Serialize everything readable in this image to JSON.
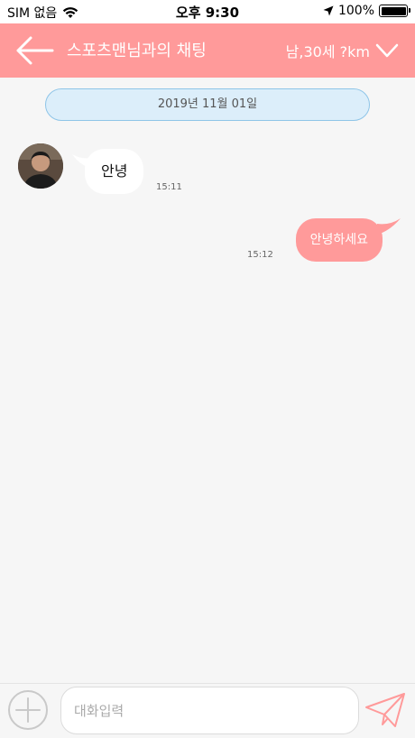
{
  "status_bar": {
    "carrier": "SIM 없음",
    "time": "오후 9:30",
    "battery": "100%",
    "battery_level": 1.0
  },
  "nav": {
    "title": "스포츠맨님과의 채팅",
    "partner_info": "남,30세 ?km"
  },
  "chat": {
    "date": "2019년 11월 01일",
    "messages": [
      {
        "direction": "incoming",
        "text": "안녕",
        "time": "15:11"
      },
      {
        "direction": "outgoing",
        "text": "안녕하세요",
        "time": "15:12"
      }
    ]
  },
  "input": {
    "placeholder": "대화입력",
    "value": ""
  },
  "colors": {
    "accent": "#ff9a9a",
    "date_pill_bg": "#dceefa",
    "date_pill_border": "#8fc5e8",
    "background": "#f6f6f6"
  },
  "icons": {
    "back": "arrow-left-icon",
    "dropdown": "chevron-down-icon",
    "plus": "plus-circle-icon",
    "send": "paper-plane-icon",
    "wifi": "wifi-icon",
    "location": "location-arrow-icon",
    "battery": "battery-icon"
  }
}
